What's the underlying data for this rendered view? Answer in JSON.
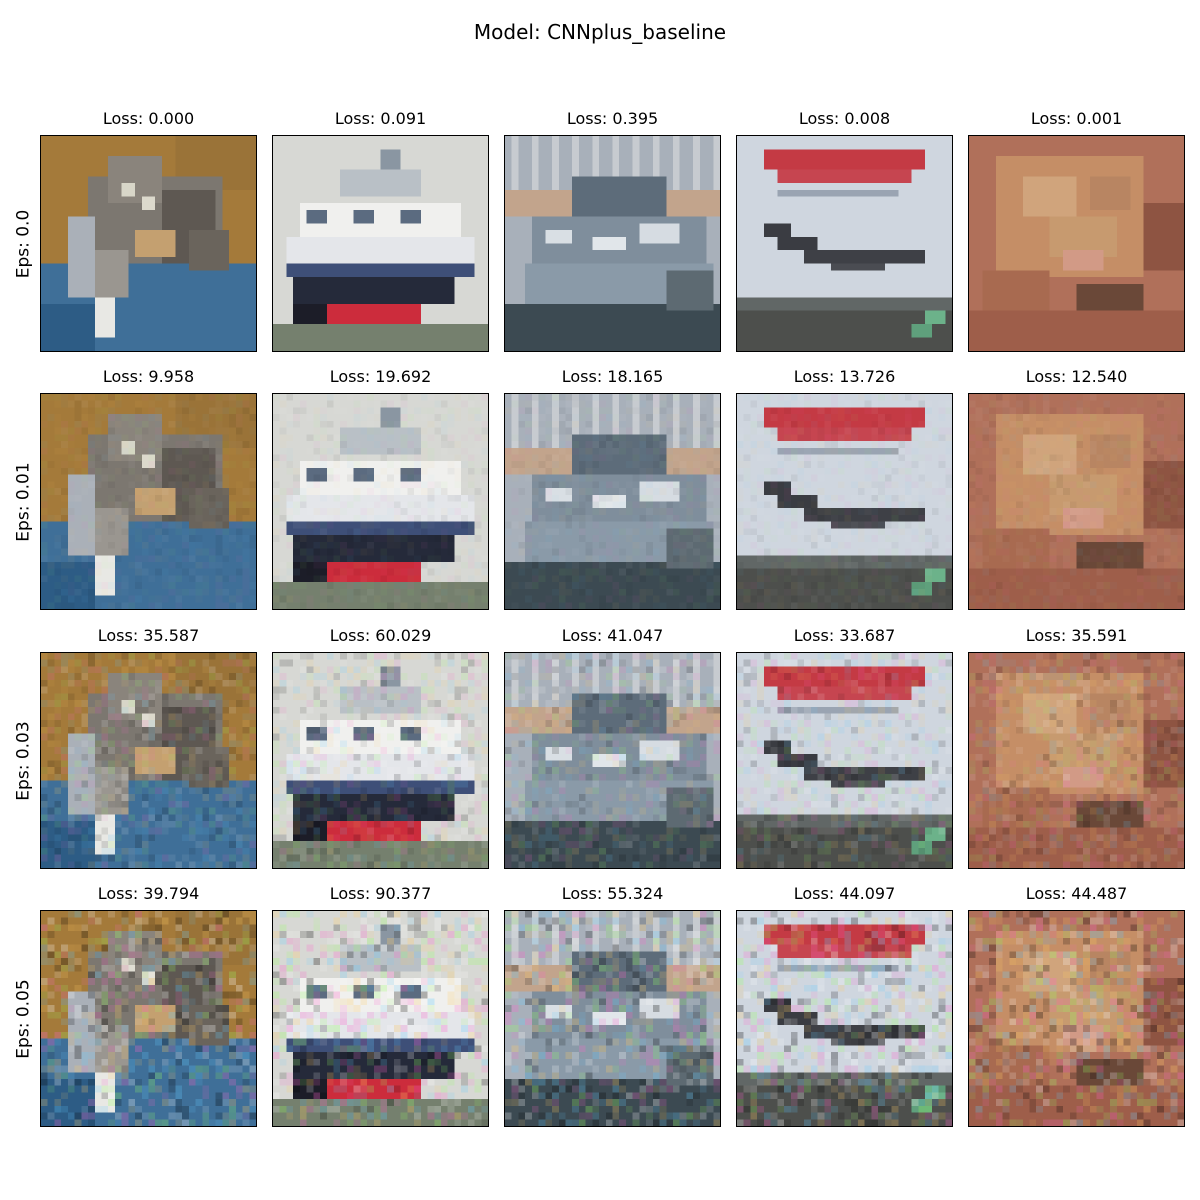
{
  "title": "Model: CNNplus_baseline",
  "chart_data": {
    "type": "image_grid",
    "title": "Model: CNNplus_baseline",
    "rows": [
      {
        "label": "Eps: 0.0",
        "eps": 0.0,
        "losses": [
          "Loss: 0.000",
          "Loss: 0.091",
          "Loss: 0.395",
          "Loss: 0.008",
          "Loss: 0.001"
        ]
      },
      {
        "label": "Eps: 0.01",
        "eps": 0.01,
        "losses": [
          "Loss: 9.958",
          "Loss: 19.692",
          "Loss: 18.165",
          "Loss: 13.726",
          "Loss: 12.540"
        ]
      },
      {
        "label": "Eps: 0.03",
        "eps": 0.03,
        "losses": [
          "Loss: 35.587",
          "Loss: 60.029",
          "Loss: 41.047",
          "Loss: 33.687",
          "Loss: 35.591"
        ]
      },
      {
        "label": "Eps: 0.05",
        "eps": 0.05,
        "losses": [
          "Loss: 39.794",
          "Loss: 90.377",
          "Loss: 55.324",
          "Loss: 44.097",
          "Loss: 44.487"
        ]
      }
    ],
    "columns": [
      "cat",
      "ship",
      "ship",
      "airplane",
      "frog"
    ],
    "grid": false,
    "legend": "none"
  },
  "images": [
    {
      "subject": "cat-image"
    },
    {
      "subject": "ship-image"
    },
    {
      "subject": "boat-image"
    },
    {
      "subject": "airplane-image"
    },
    {
      "subject": "frog-image"
    }
  ]
}
